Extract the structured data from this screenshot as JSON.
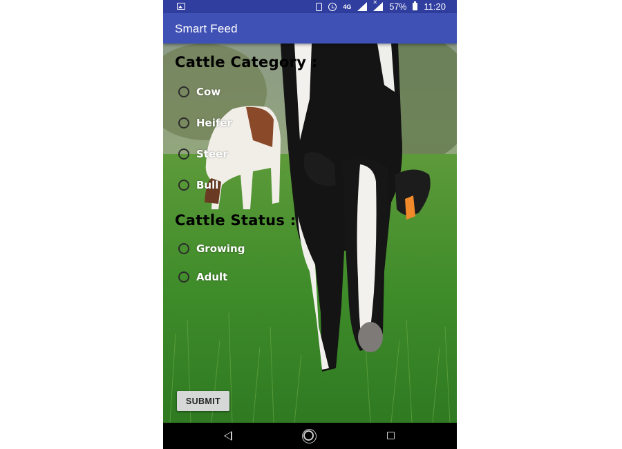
{
  "status_bar": {
    "network": "4G",
    "battery": "57%",
    "time": "11:20"
  },
  "app_bar": {
    "title": "Smart Feed"
  },
  "form": {
    "category_title": "Cattle Category :",
    "category_options": [
      "Cow",
      "Heifer",
      "Steer",
      "Bull"
    ],
    "status_title": "Cattle Status :",
    "status_options": [
      "Growing",
      "Adult"
    ],
    "submit_label": "SUBMIT"
  },
  "colors": {
    "status_bar": "#303f9f",
    "app_bar": "#3f51b5",
    "button": "#d6d7d7"
  },
  "icons": {
    "status_left": "gallery-icon",
    "status_right": [
      "vibrate-icon",
      "alarm-icon",
      "network-4g-icon",
      "signal-icon",
      "no-signal-icon",
      "battery-icon"
    ],
    "nav": [
      "back-icon",
      "home-icon",
      "recent-apps-icon"
    ]
  }
}
